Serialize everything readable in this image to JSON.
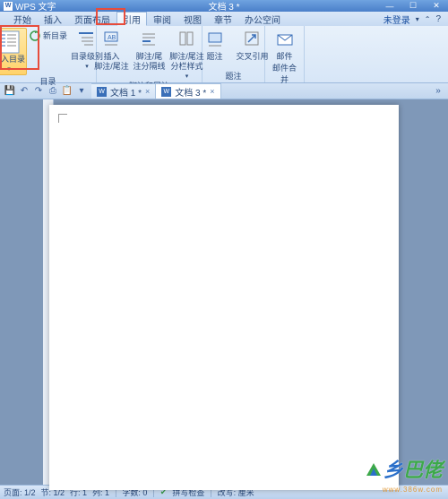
{
  "title": "文档 3 *",
  "app_label": "WPS 文字",
  "window_buttons": {
    "min": "—",
    "max": "☐",
    "close": "✕"
  },
  "menu": {
    "items": [
      "开始",
      "插入",
      "页面布局",
      "引用",
      "审阅",
      "视图",
      "章节",
      "办公空间"
    ],
    "active_index": 3,
    "help": "未登录",
    "dropdown": "▾",
    "help_icon": "?"
  },
  "ribbon": {
    "groups": [
      {
        "name": "目录",
        "items": [
          {
            "id": "insert-toc",
            "label": "插入目录",
            "highlighted": true
          },
          {
            "id": "update-toc",
            "label": "新目录",
            "small": true
          },
          {
            "id": "toc-level",
            "label": "目录级别",
            "dropdown": true
          }
        ]
      },
      {
        "name": "脚注和尾注",
        "items": [
          {
            "id": "insert-footnote",
            "label": "插入\n脚注/尾注"
          },
          {
            "id": "footnote-sep",
            "label": "脚注/尾\n注分隔线"
          },
          {
            "id": "footnote-opts",
            "label": "脚注/尾注\n分栏样式",
            "dropdown": true
          }
        ]
      },
      {
        "name": "题注",
        "items": [
          {
            "id": "caption",
            "label": "题注"
          },
          {
            "id": "cross-ref",
            "label": "交叉引用"
          }
        ]
      },
      {
        "name": "邮件合并",
        "items": [
          {
            "id": "mail-merge",
            "label": "邮件"
          }
        ]
      }
    ]
  },
  "qat": {
    "icons": [
      "save",
      "undo",
      "redo",
      "print",
      "paste",
      "more"
    ]
  },
  "doc_tabs": {
    "tabs": [
      {
        "label": "文档 1 *",
        "active": false
      },
      {
        "label": "文档 3 *",
        "active": true
      }
    ],
    "close": "×",
    "overflow": "»"
  },
  "status": {
    "page": "页面: 1/2",
    "section": "节: 1/2",
    "pos": "行: 1",
    "col": "列: 1",
    "words": "字数: 0",
    "spell": "拼写检查",
    "mode": "改写: 厘米"
  },
  "watermark": {
    "brand_a": "乡",
    "brand_b": "巴",
    "brand_c": "佬",
    "url": "www.386w.com"
  }
}
